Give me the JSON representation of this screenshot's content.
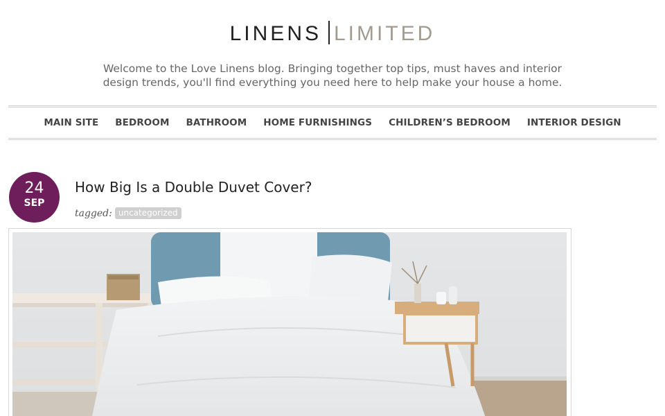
{
  "header": {
    "logo_left": "LINENS",
    "logo_right": "LIMITED",
    "tagline": "Welcome to the Love Linens blog. Bringing together top tips, must haves and interior design trends, you'll find everything you need here to help make your house a home."
  },
  "nav": {
    "items": [
      "MAIN SITE",
      "BEDROOM",
      "BATHROOM",
      "HOME FURNISHINGS",
      "CHILDREN’S BEDROOM",
      "INTERIOR DESIGN"
    ]
  },
  "post": {
    "day": "24",
    "month": "SEP",
    "title": "How Big Is a Double Duvet Cover?",
    "tagged_label": "tagged:",
    "tag": "uncategorized"
  },
  "colors": {
    "accent": "#6e1e5a",
    "tag_bg": "#cfcfcf",
    "logo_secondary": "#a39a90"
  }
}
